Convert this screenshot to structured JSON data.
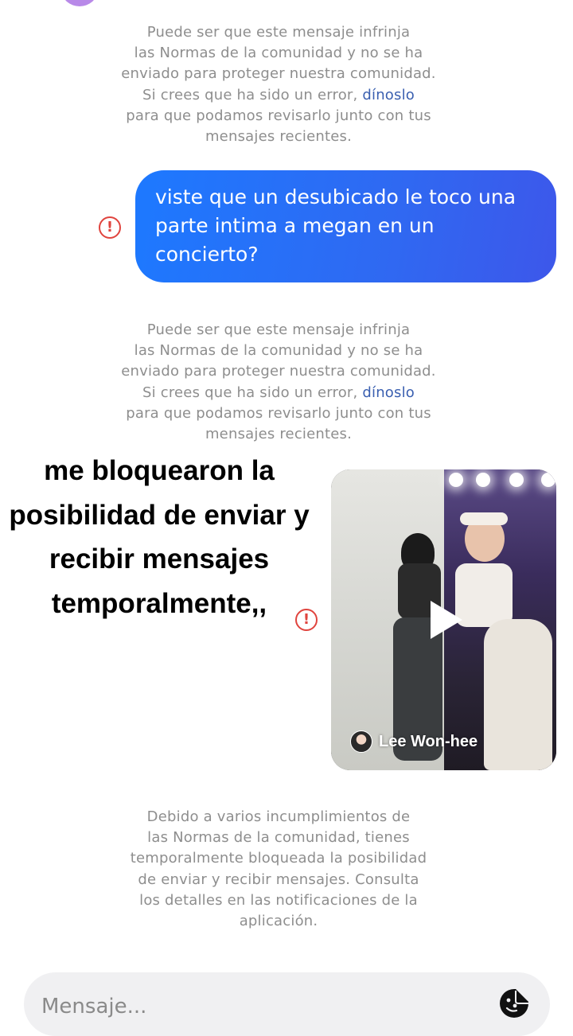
{
  "notice1": {
    "line1": "Puede ser que este mensaje infrinja",
    "line2": "las Normas de la comunidad y no se ha",
    "line3": "enviado para proteger nuestra comunidad.",
    "line4_prefix": "Si crees que ha sido un error, ",
    "link": "dínoslo",
    "line5": "para que podamos revisarlo junto con tus",
    "line6": "mensajes recientes."
  },
  "message": {
    "line1": "viste que un desubicado le toco una",
    "line2": "parte intima a megan en un",
    "line3": "concierto?"
  },
  "notice2": {
    "line1": "Puede ser que este mensaje infrinja",
    "line2": "las Normas de la comunidad y no se ha",
    "line3": "enviado para proteger nuestra comunidad.",
    "line4_prefix": "Si crees que ha sido un error, ",
    "link": "dínoslo",
    "line5": "para que podamos revisarlo junto con tus",
    "line6": "mensajes recientes."
  },
  "overlay_caption": {
    "line1": "me  bloquearon la",
    "line2": "posibilidad de enviar y",
    "line3": "recibir mensajes",
    "line4": "temporalmente,,"
  },
  "video": {
    "author": "Lee Won-hee"
  },
  "block_notice": {
    "line1": "Debido a varios incumplimientos de",
    "line2": "las Normas de la comunidad, tienes",
    "line3": "temporalmente bloqueada la posibilidad",
    "line4": "de enviar y recibir mensajes. Consulta",
    "line5": "los detalles en las notificaciones de la",
    "line6": "aplicación."
  },
  "composer": {
    "placeholder": "Mensaje..."
  },
  "icons": {
    "error": "error-circle-icon",
    "play": "play-icon",
    "sticker": "sticker-icon"
  },
  "colors": {
    "bubble_start": "#1d79ff",
    "bubble_end": "#3d57ea",
    "error_red": "#e0443e",
    "link_blue": "#3a5fb0",
    "notice_gray": "#8e8e8e"
  }
}
